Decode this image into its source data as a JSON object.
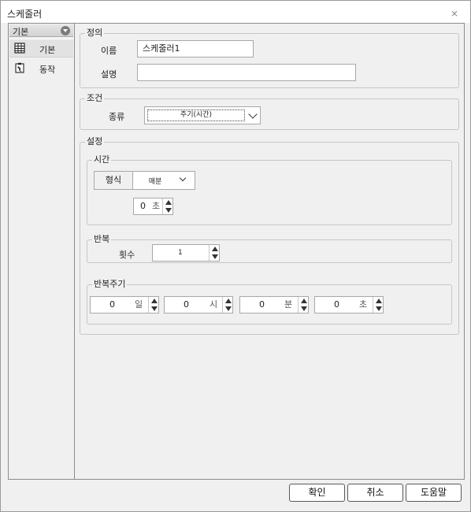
{
  "window": {
    "title": "스케줄러",
    "close_glyph": "⨯"
  },
  "sidebar": {
    "header_label": "기본",
    "items": [
      {
        "label": "기본",
        "icon": "table-grid-icon",
        "active": true
      },
      {
        "label": "동작",
        "icon": "task-clipboard-icon",
        "active": false
      }
    ]
  },
  "definition": {
    "legend": "정의",
    "name_label": "이름",
    "name_value": "스케줄러1",
    "desc_label": "설명",
    "desc_value": ""
  },
  "condition": {
    "legend": "조건",
    "type_label": "종류",
    "type_value": "주기(시간)"
  },
  "settings": {
    "legend": "설정",
    "time": {
      "legend": "시간",
      "format_label": "형식",
      "format_value": "매분",
      "seconds_value": "0",
      "seconds_unit": "초"
    },
    "repeat": {
      "legend": "반복",
      "count_label": "횟수",
      "count_value": "1"
    },
    "period": {
      "legend": "반복주기",
      "fields": [
        {
          "value": "0",
          "unit": "일"
        },
        {
          "value": "0",
          "unit": "시"
        },
        {
          "value": "0",
          "unit": "분"
        },
        {
          "value": "0",
          "unit": "초"
        }
      ]
    }
  },
  "buttons": {
    "ok": "확인",
    "cancel": "취소",
    "help": "도움말"
  }
}
